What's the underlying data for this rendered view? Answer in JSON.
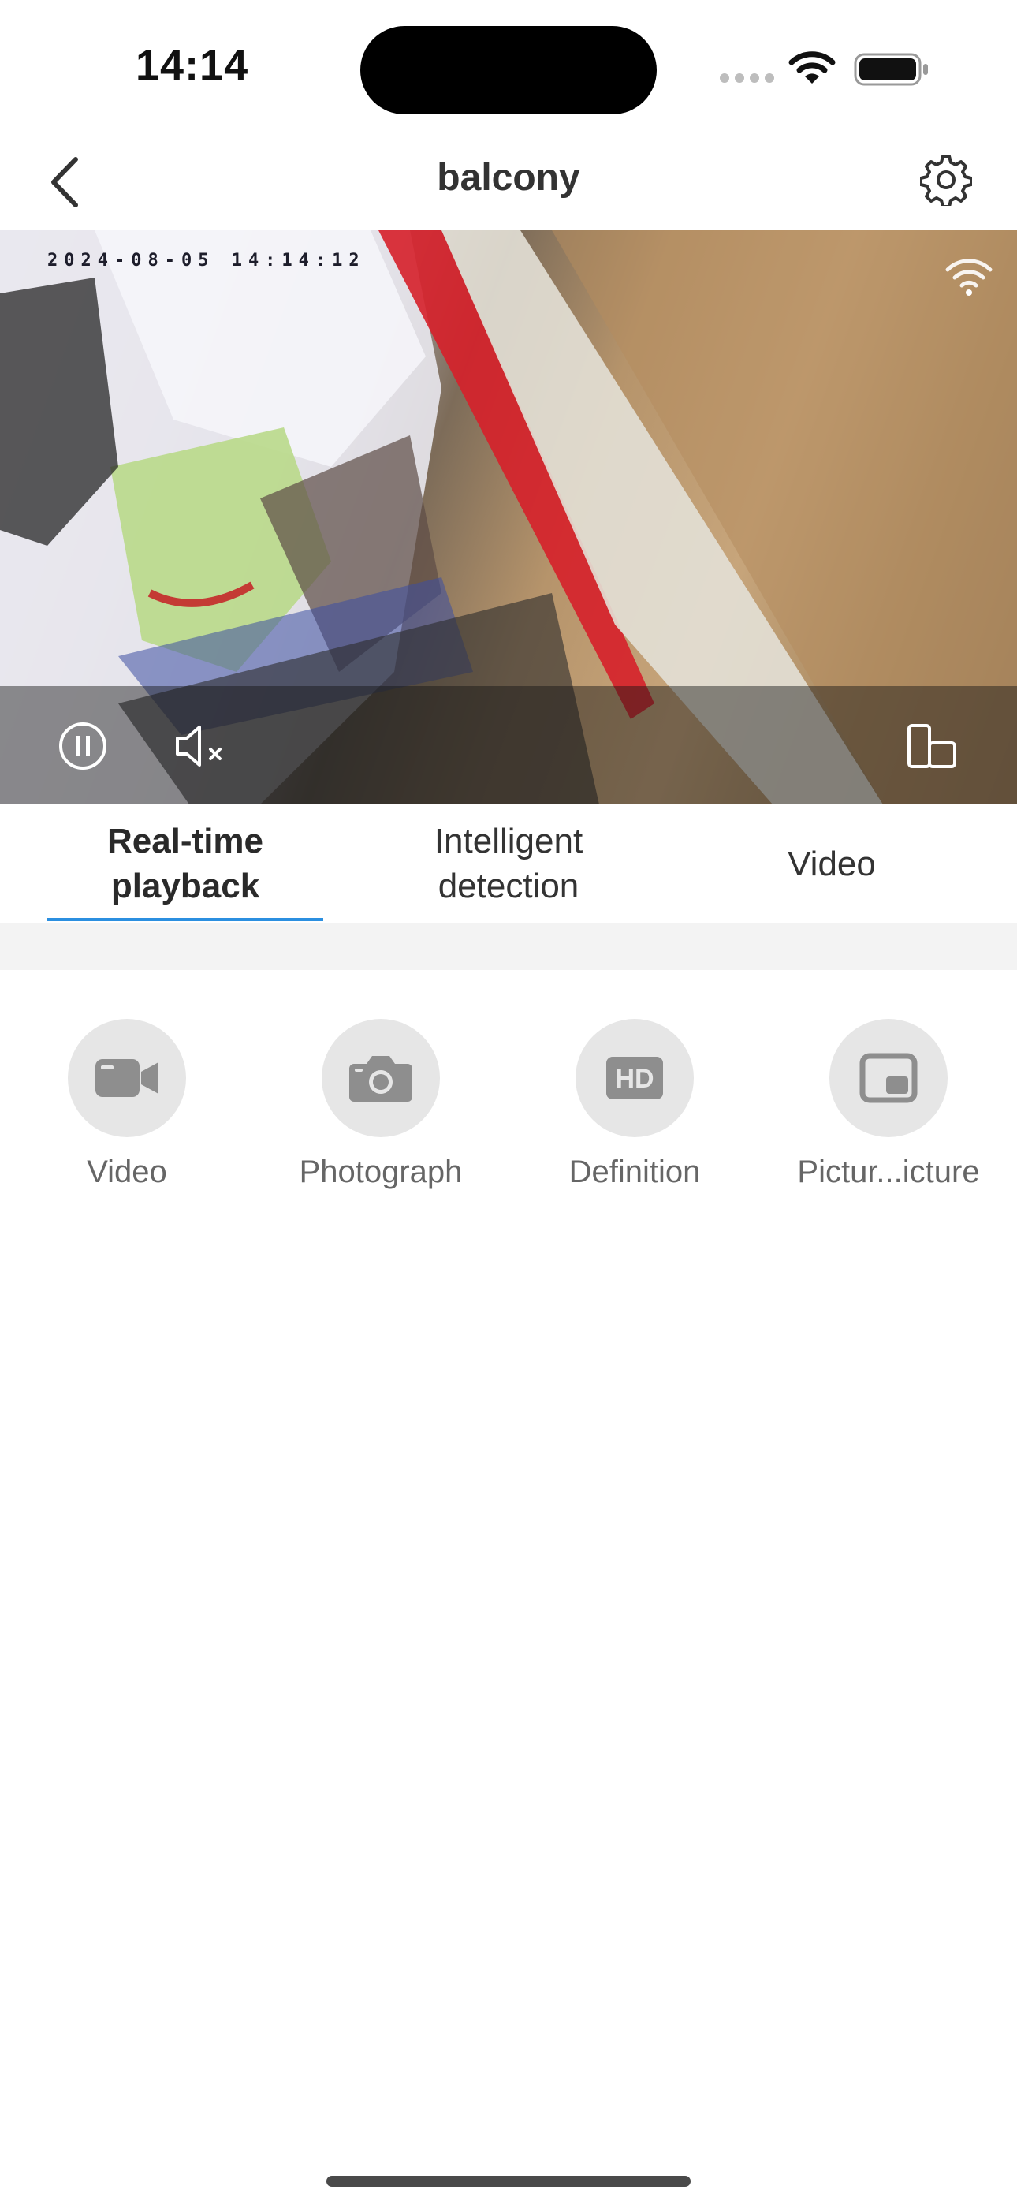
{
  "status_bar": {
    "time": "14:14"
  },
  "nav": {
    "title": "balcony"
  },
  "feed": {
    "timestamp": "2024-08-05  14:14:12"
  },
  "tabs": [
    {
      "label": "Real-time playback",
      "active": true
    },
    {
      "label": "Intelligent detection",
      "active": false
    },
    {
      "label": "Video",
      "active": false
    }
  ],
  "functions": [
    {
      "label": "Video",
      "icon": "video-camera-icon"
    },
    {
      "label": "Photograph",
      "icon": "camera-icon"
    },
    {
      "label": "Definition",
      "icon": "hd-icon"
    },
    {
      "label": "Pictur...icture",
      "icon": "picture-in-picture-icon"
    }
  ],
  "colors": {
    "accent": "#2b8fe0",
    "icon_gray": "#8e8e8e",
    "circle_bg": "#e6e6e6"
  }
}
